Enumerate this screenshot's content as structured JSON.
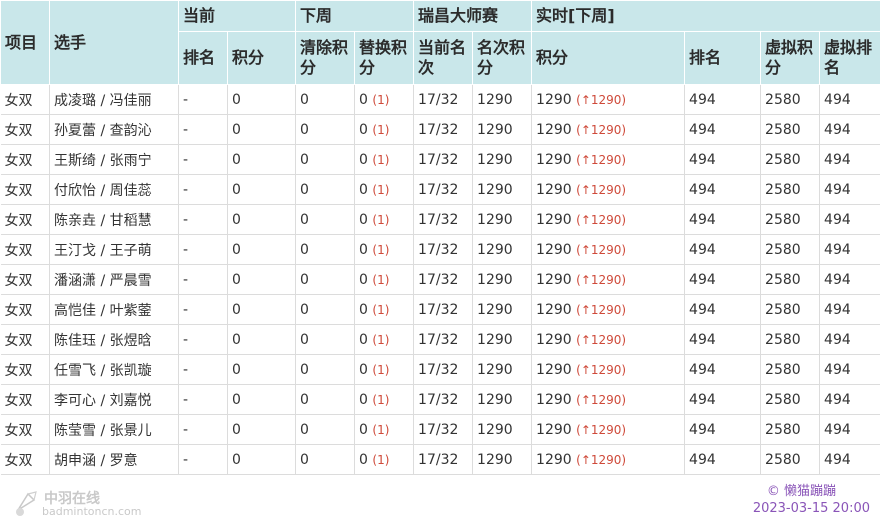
{
  "header": {
    "col_event": "项目",
    "col_player": "选手",
    "group_current": "当前",
    "group_next_week": "下周",
    "group_tournament": "瑞昌大师赛",
    "group_realtime": "实时[下周]",
    "sub_rank": "排名",
    "sub_points": "积分",
    "sub_clear_points": "清除积分",
    "sub_replace_points": "替换积分",
    "sub_current_place": "当前名次",
    "sub_place_points": "名次积分",
    "sub_rt_points": "积分",
    "sub_rt_rank": "排名",
    "sub_virtual_points": "虚拟积分",
    "sub_virtual_rank": "虚拟排名"
  },
  "rows": [
    {
      "event": "女双",
      "players": "成凌璐 / 冯佳丽",
      "cur_rank": "-",
      "cur_points": "0",
      "clear": "0",
      "replace": "0",
      "replace_delta": "(1)",
      "place": "17/32",
      "place_points": "1290",
      "rt_points": "1290",
      "rt_delta": "(↑1290)",
      "rt_rank": "494",
      "v_points": "2580",
      "v_rank": "494"
    },
    {
      "event": "女双",
      "players": "孙夏蕾 / 查韵沁",
      "cur_rank": "-",
      "cur_points": "0",
      "clear": "0",
      "replace": "0",
      "replace_delta": "(1)",
      "place": "17/32",
      "place_points": "1290",
      "rt_points": "1290",
      "rt_delta": "(↑1290)",
      "rt_rank": "494",
      "v_points": "2580",
      "v_rank": "494"
    },
    {
      "event": "女双",
      "players": "王斯绮 / 张雨宁",
      "cur_rank": "-",
      "cur_points": "0",
      "clear": "0",
      "replace": "0",
      "replace_delta": "(1)",
      "place": "17/32",
      "place_points": "1290",
      "rt_points": "1290",
      "rt_delta": "(↑1290)",
      "rt_rank": "494",
      "v_points": "2580",
      "v_rank": "494"
    },
    {
      "event": "女双",
      "players": "付欣怡 / 周佳蕊",
      "cur_rank": "-",
      "cur_points": "0",
      "clear": "0",
      "replace": "0",
      "replace_delta": "(1)",
      "place": "17/32",
      "place_points": "1290",
      "rt_points": "1290",
      "rt_delta": "(↑1290)",
      "rt_rank": "494",
      "v_points": "2580",
      "v_rank": "494"
    },
    {
      "event": "女双",
      "players": "陈亲垚 / 甘稻慧",
      "cur_rank": "-",
      "cur_points": "0",
      "clear": "0",
      "replace": "0",
      "replace_delta": "(1)",
      "place": "17/32",
      "place_points": "1290",
      "rt_points": "1290",
      "rt_delta": "(↑1290)",
      "rt_rank": "494",
      "v_points": "2580",
      "v_rank": "494"
    },
    {
      "event": "女双",
      "players": "王汀戈 / 王子萌",
      "cur_rank": "-",
      "cur_points": "0",
      "clear": "0",
      "replace": "0",
      "replace_delta": "(1)",
      "place": "17/32",
      "place_points": "1290",
      "rt_points": "1290",
      "rt_delta": "(↑1290)",
      "rt_rank": "494",
      "v_points": "2580",
      "v_rank": "494"
    },
    {
      "event": "女双",
      "players": "潘涵潇 / 严晨雪",
      "cur_rank": "-",
      "cur_points": "0",
      "clear": "0",
      "replace": "0",
      "replace_delta": "(1)",
      "place": "17/32",
      "place_points": "1290",
      "rt_points": "1290",
      "rt_delta": "(↑1290)",
      "rt_rank": "494",
      "v_points": "2580",
      "v_rank": "494"
    },
    {
      "event": "女双",
      "players": "高恺佳 / 叶紫蓥",
      "cur_rank": "-",
      "cur_points": "0",
      "clear": "0",
      "replace": "0",
      "replace_delta": "(1)",
      "place": "17/32",
      "place_points": "1290",
      "rt_points": "1290",
      "rt_delta": "(↑1290)",
      "rt_rank": "494",
      "v_points": "2580",
      "v_rank": "494"
    },
    {
      "event": "女双",
      "players": "陈佳珏 / 张煜晗",
      "cur_rank": "-",
      "cur_points": "0",
      "clear": "0",
      "replace": "0",
      "replace_delta": "(1)",
      "place": "17/32",
      "place_points": "1290",
      "rt_points": "1290",
      "rt_delta": "(↑1290)",
      "rt_rank": "494",
      "v_points": "2580",
      "v_rank": "494"
    },
    {
      "event": "女双",
      "players": "任雪飞 / 张凯璇",
      "cur_rank": "-",
      "cur_points": "0",
      "clear": "0",
      "replace": "0",
      "replace_delta": "(1)",
      "place": "17/32",
      "place_points": "1290",
      "rt_points": "1290",
      "rt_delta": "(↑1290)",
      "rt_rank": "494",
      "v_points": "2580",
      "v_rank": "494"
    },
    {
      "event": "女双",
      "players": "李可心 / 刘嘉悦",
      "cur_rank": "-",
      "cur_points": "0",
      "clear": "0",
      "replace": "0",
      "replace_delta": "(1)",
      "place": "17/32",
      "place_points": "1290",
      "rt_points": "1290",
      "rt_delta": "(↑1290)",
      "rt_rank": "494",
      "v_points": "2580",
      "v_rank": "494"
    },
    {
      "event": "女双",
      "players": "陈莹雪 / 张景儿",
      "cur_rank": "-",
      "cur_points": "0",
      "clear": "0",
      "replace": "0",
      "replace_delta": "(1)",
      "place": "17/32",
      "place_points": "1290",
      "rt_points": "1290",
      "rt_delta": "(↑1290)",
      "rt_rank": "494",
      "v_points": "2580",
      "v_rank": "494"
    },
    {
      "event": "女双",
      "players": "胡申涵 / 罗意",
      "cur_rank": "-",
      "cur_points": "0",
      "clear": "0",
      "replace": "0",
      "replace_delta": "(1)",
      "place": "17/32",
      "place_points": "1290",
      "rt_points": "1290",
      "rt_delta": "(↑1290)",
      "rt_rank": "494",
      "v_points": "2580",
      "v_rank": "494"
    }
  ],
  "footer": {
    "logo_name": "中羽在线",
    "logo_domain": "badmintoncn.com",
    "logo_icon": "badminton-shuttle-icon",
    "credit": "© 懒猫蹦蹦",
    "date": "2023-03-15 20:00"
  },
  "colors": {
    "header_bg": "#c9e7ea",
    "green": "#1aa51a",
    "red": "#cf4a3a",
    "credit": "#8a55b8"
  }
}
